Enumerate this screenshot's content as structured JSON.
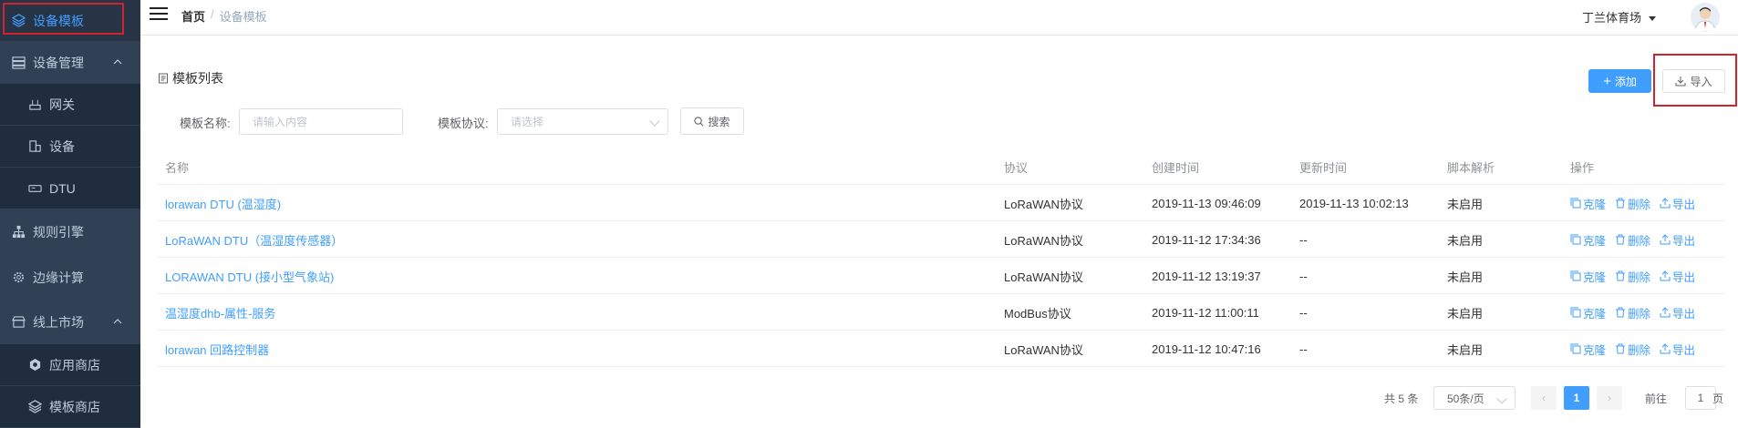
{
  "sidebar": {
    "items": [
      {
        "label": "设备模板",
        "icon": "layers-icon"
      },
      {
        "label": "设备管理",
        "icon": "server-icon"
      },
      {
        "label": "网关",
        "icon": "gateway-icon"
      },
      {
        "label": "设备",
        "icon": "device-icon"
      },
      {
        "label": "DTU",
        "icon": "dtu-icon"
      },
      {
        "label": "规则引擎",
        "icon": "hierarchy-icon"
      },
      {
        "label": "边缘计算",
        "icon": "gear-icon"
      },
      {
        "label": "线上市场",
        "icon": "store-icon"
      },
      {
        "label": "应用商店",
        "icon": "hexagon-icon"
      },
      {
        "label": "模板商店",
        "icon": "layers-icon"
      }
    ]
  },
  "header": {
    "breadcrumb_home": "首页",
    "breadcrumb_sep": "/",
    "breadcrumb_current": "设备模板",
    "user_name": "丁兰体育场"
  },
  "card": {
    "title": "模板列表",
    "add_label": "添加",
    "import_label": "导入"
  },
  "filters": {
    "name_label": "模板名称:",
    "name_placeholder": "请输入内容",
    "protocol_label": "模板协议:",
    "protocol_placeholder": "请选择",
    "search_label": "搜索"
  },
  "table": {
    "headers": [
      "名称",
      "协议",
      "创建时间",
      "更新时间",
      "脚本解析",
      "操作"
    ],
    "rows": [
      {
        "name": "lorawan DTU (温湿度)",
        "protocol": "LoRaWAN协议",
        "created": "2019-11-13 09:46:09",
        "updated": "2019-11-13 10:02:13",
        "script": "未启用"
      },
      {
        "name": "LoRaWAN DTU（温湿度传感器）",
        "protocol": "LoRaWAN协议",
        "created": "2019-11-12 17:34:36",
        "updated": "--",
        "script": "未启用"
      },
      {
        "name": "LORAWAN DTU (接小型气象站)",
        "protocol": "LoRaWAN协议",
        "created": "2019-11-12 13:19:37",
        "updated": "--",
        "script": "未启用"
      },
      {
        "name": "温湿度dhb-属性-服务",
        "protocol": "ModBus协议",
        "created": "2019-11-12 11:00:11",
        "updated": "--",
        "script": "未启用"
      },
      {
        "name": "lorawan 回路控制器",
        "protocol": "LoRaWAN协议",
        "created": "2019-11-12 10:47:16",
        "updated": "--",
        "script": "未启用"
      }
    ],
    "ops": {
      "clone": "克隆",
      "delete": "删除",
      "export": "导出"
    }
  },
  "pagination": {
    "total": "共 5 条",
    "page_size": "50条/页",
    "current_page": "1",
    "goto_label": "前往",
    "goto_value": "1",
    "page_suffix": "页"
  },
  "colors": {
    "sidebar_bg": "#304156",
    "accent": "#409eff",
    "highlight_box": "#d1232e"
  }
}
